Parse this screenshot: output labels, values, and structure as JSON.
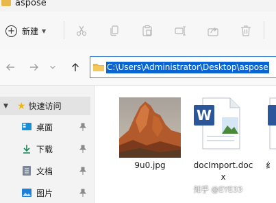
{
  "window": {
    "title": "aspose"
  },
  "toolbar": {
    "new_label": "新建",
    "icons": [
      "cut-icon",
      "copy-icon",
      "paste-icon",
      "rename-icon",
      "share-icon",
      "delete-icon"
    ]
  },
  "address": {
    "path": "C:\\Users\\Administrator\\Desktop\\aspose"
  },
  "sidebar": {
    "quick_access": "快速访问",
    "items": [
      {
        "label": "桌面",
        "icon": "desktop-icon"
      },
      {
        "label": "下载",
        "icon": "download-icon"
      },
      {
        "label": "文档",
        "icon": "documents-icon"
      },
      {
        "label": "图片",
        "icon": "pictures-icon"
      }
    ]
  },
  "files": [
    {
      "name": "9u0.jpg",
      "icon": "image-thumbnail"
    },
    {
      "name_line1": "docImport.doc",
      "name_line2": "x",
      "icon": "word-document-icon"
    },
    {
      "name": "纟",
      "icon": "word-document-icon"
    }
  ],
  "watermark": "知乎 @EYE33",
  "colors": {
    "selection": "#0a64d2",
    "address_border": "#2b7cd3",
    "quick_access_bg": "#e3e3e3",
    "folder": "#e8b84a"
  }
}
